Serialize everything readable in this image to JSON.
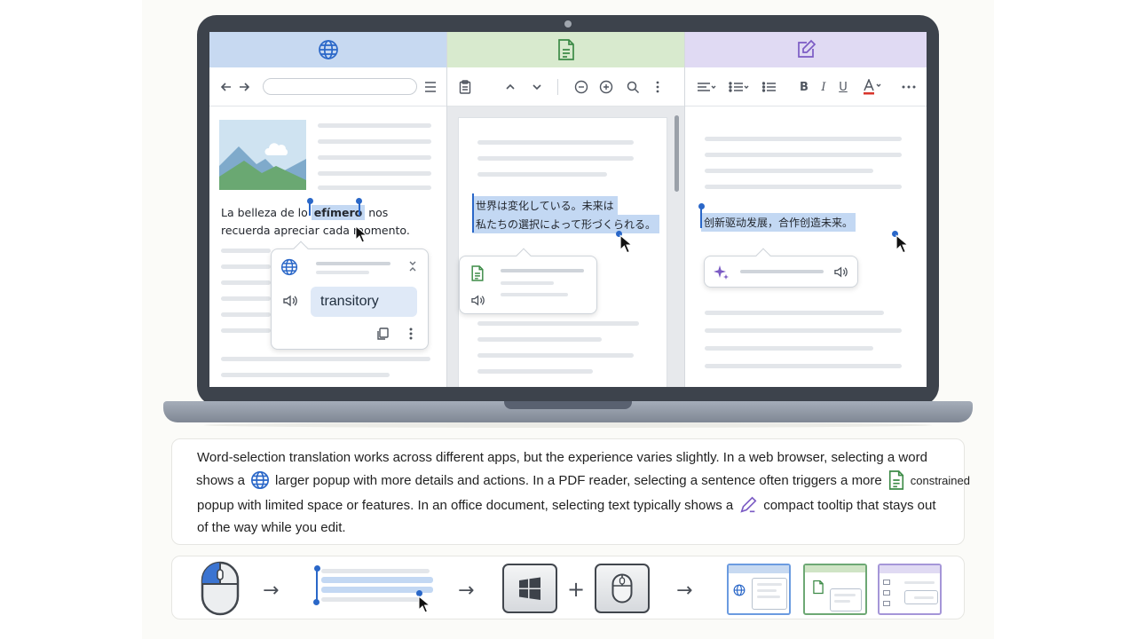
{
  "browser_panel": {
    "paragraph_line1_pre": "La belleza de lo",
    "selected_word": "efímero",
    "paragraph_line1_post": "nos",
    "paragraph_line2": "recuerda apreciar cada  momento.",
    "popup_translation": "transitory"
  },
  "pdf_panel": {
    "selection_line1": "世界は変化している。未来は",
    "selection_line2": "私たちの選択によって形づくられる。"
  },
  "office_panel": {
    "selection_text": "创新驱动发展，合作创造未来。"
  },
  "caption": {
    "line1": "Word-selection translation works across different apps, but the experience varies slightly. In a web browser, selecting a word",
    "line2_a": "shows a",
    "line2_b": "larger popup with more details and actions. In a PDF reader, selecting a sentence often triggers a more",
    "line2_c": "constrained",
    "line3_a": "popup with limited space or features. In an office document, selecting text typically shows a",
    "line3_b": "compact tooltip that stays out",
    "line4": "of the way while you edit."
  },
  "flow": {
    "arrow": "→",
    "plus": "+"
  },
  "colors": {
    "browser_accent": "#2a67c8",
    "pdf_accent": "#3d8b47",
    "office_accent": "#7b5bc4",
    "selection_highlight": "#c3d8f3"
  },
  "icons": [
    "globe-icon",
    "document-icon",
    "pencil-edit-icon",
    "speaker-icon",
    "copy-icon",
    "sparkle-icon",
    "mouse-icon",
    "windows-key-icon",
    "cursor-icon"
  ]
}
